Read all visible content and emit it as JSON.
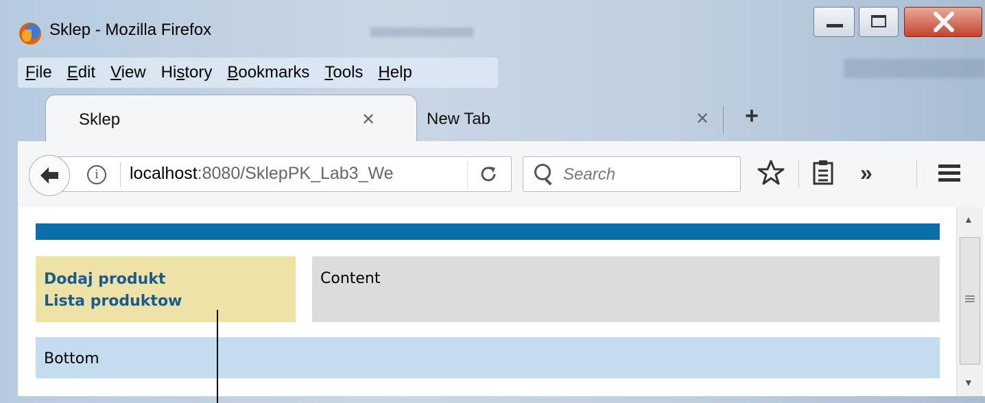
{
  "window": {
    "title": "Sklep - Mozilla Firefox"
  },
  "menubar": {
    "items": [
      {
        "label": "File",
        "accel": "F",
        "rest": "ile"
      },
      {
        "label": "Edit",
        "accel": "E",
        "rest": "dit"
      },
      {
        "label": "View",
        "accel": "V",
        "rest": "iew"
      },
      {
        "label": "History",
        "pre": "Hi",
        "accel": "s",
        "rest": "tory"
      },
      {
        "label": "Bookmarks",
        "accel": "B",
        "rest": "ookmarks"
      },
      {
        "label": "Tools",
        "accel": "T",
        "rest": "ools"
      },
      {
        "label": "Help",
        "accel": "H",
        "rest": "elp"
      }
    ]
  },
  "tabs": [
    {
      "label": "Sklep",
      "active": true
    },
    {
      "label": "New Tab",
      "active": false
    }
  ],
  "newtab_symbol": "+",
  "toolbar": {
    "url_host": "localhost",
    "url_rest": ":8080/SklepPK_Lab3_We",
    "search_placeholder": "Search",
    "overflow_symbol": "»"
  },
  "page": {
    "menu_links": [
      "Dodaj produkt",
      "Lista produktow"
    ],
    "content_text": "Content",
    "bottom_text": "Bottom"
  },
  "colors": {
    "header_strip": "#0a6ea8",
    "menu_bg": "#eee2a6",
    "content_bg": "#dcdcdc",
    "bottom_bg": "#c3ddef",
    "link": "#1b5b8f"
  }
}
